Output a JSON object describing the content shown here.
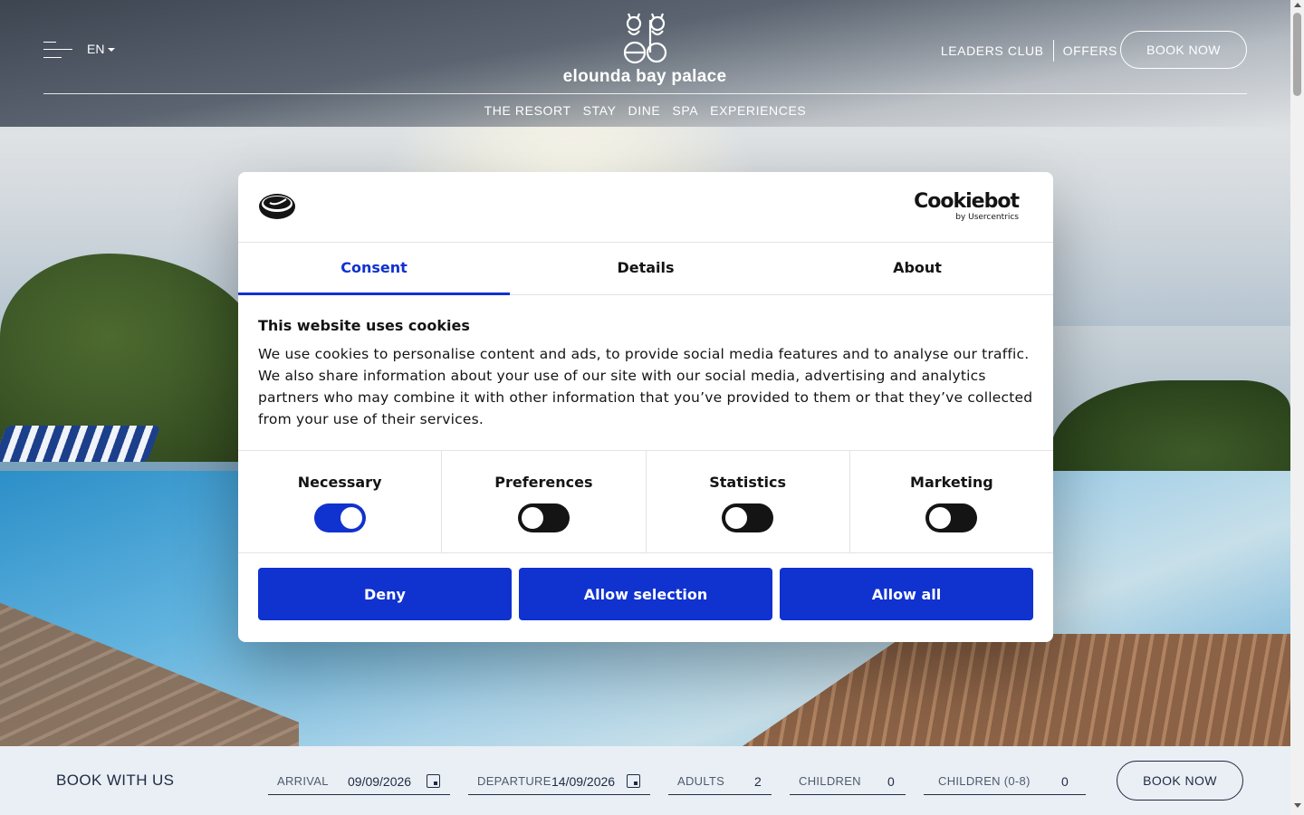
{
  "header": {
    "language": "EN",
    "logo_text": "elounda bay palace",
    "links": [
      "LEADERS CLUB",
      "OFFERS"
    ],
    "book_now": "BOOK NOW",
    "nav": [
      "THE RESORT",
      "STAY",
      "DINE",
      "SPA",
      "EXPERIENCES"
    ]
  },
  "cookie_dialog": {
    "brand": "Cookiebot",
    "brand_sub": "by Usercentrics",
    "tabs": [
      {
        "label": "Consent",
        "active": true
      },
      {
        "label": "Details",
        "active": false
      },
      {
        "label": "About",
        "active": false
      }
    ],
    "title": "This website uses cookies",
    "text": "We use cookies to personalise content and ads, to provide social media features and to analyse our traffic. We also share information about your use of our site with our social media, advertising and analytics partners who may combine it with other information that you’ve provided to them or that they’ve collected from your use of their services.",
    "categories": [
      {
        "label": "Necessary",
        "checked": true
      },
      {
        "label": "Preferences",
        "checked": false
      },
      {
        "label": "Statistics",
        "checked": false
      },
      {
        "label": "Marketing",
        "checked": false
      }
    ],
    "buttons": {
      "deny": "Deny",
      "allow_selection": "Allow selection",
      "allow_all": "Allow all"
    },
    "accent_color": "#1032cf"
  },
  "booking": {
    "title": "BOOK WITH US",
    "arrival_label": "ARRIVAL",
    "arrival_value": "09/09/2026",
    "departure_label": "DEPARTURE",
    "departure_value": "14/09/2026",
    "adults_label": "ADULTS",
    "adults_value": "2",
    "children_label": "CHILDREN",
    "children_value": "0",
    "children08_label": "CHILDREN (0-8)",
    "children08_value": "0",
    "book_now": "BOOK NOW"
  }
}
